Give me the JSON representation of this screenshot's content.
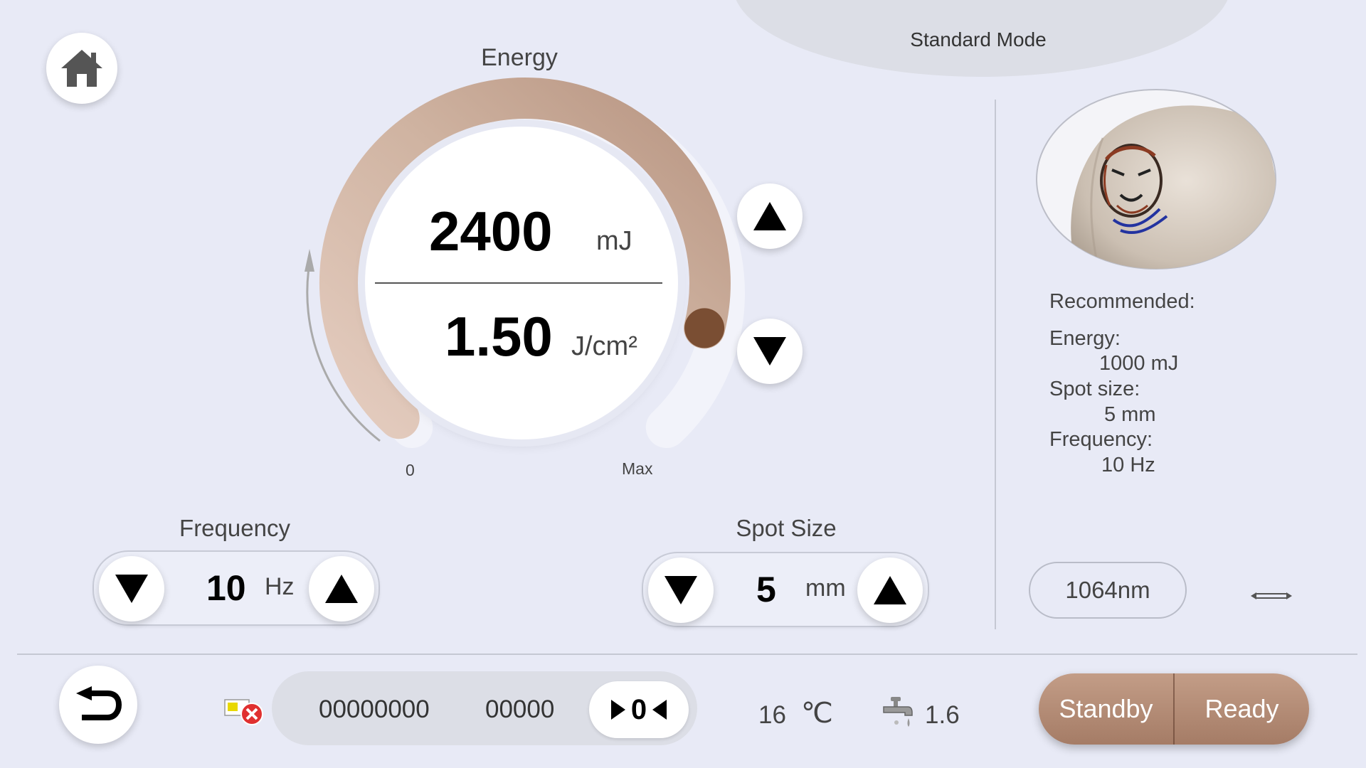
{
  "header": {
    "mode": "Standard Mode"
  },
  "energy": {
    "title": "Energy",
    "value": "2400",
    "unit": "mJ",
    "fluence": "1.50",
    "fluence_unit": "J/cm²",
    "scale_min": "0",
    "scale_max": "Max",
    "level_fraction": 0.88
  },
  "frequency": {
    "label": "Frequency",
    "value": "10",
    "unit": "Hz"
  },
  "spot_size": {
    "label": "Spot Size",
    "value": "5",
    "unit": "mm"
  },
  "recommended": {
    "title": "Recommended:",
    "energy_label": "Energy:",
    "energy_value": "1000  mJ",
    "spot_label": "Spot size:",
    "spot_value": "5  mm",
    "freq_label": "Frequency:",
    "freq_value": "10 Hz"
  },
  "wavelength": "1064nm",
  "footer": {
    "counter_total": "00000000",
    "counter_session": "00000",
    "reset_label": "0",
    "temperature": "16",
    "temp_unit": "℃",
    "water_value": "1.6",
    "standby_label": "Standby",
    "ready_label": "Ready"
  },
  "colors": {
    "background": "#e8eaf6",
    "accent": "#a57c66",
    "knob": "#7a4e33"
  }
}
